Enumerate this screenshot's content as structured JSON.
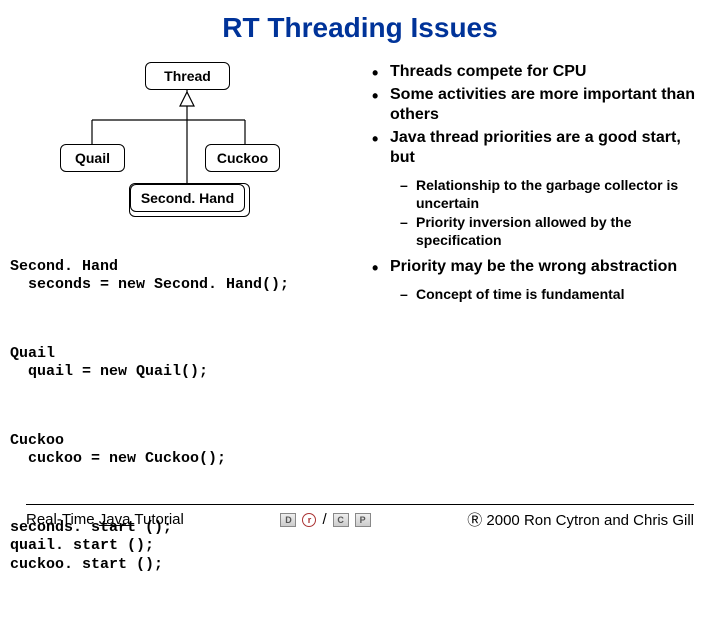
{
  "title": "RT Threading Issues",
  "diagram": {
    "thread": "Thread",
    "quail": "Quail",
    "cuckoo": "Cuckoo",
    "secondhand": "Second. Hand"
  },
  "code": {
    "sh_decl": "Second. Hand\n  seconds = new Second. Hand();",
    "quail_decl": "Quail\n  quail = new Quail();",
    "cuckoo_decl": "Cuckoo\n  cuckoo = new Cuckoo();",
    "starts": "seconds. start ();\nquail. start ();\ncuckoo. start ();"
  },
  "bullets": {
    "b1_1": "Threads compete for CPU",
    "b1_2": "Some activities are more important than others",
    "b1_3": "Java thread priorities are a good start, but",
    "b2_1": "Relationship to the garbage collector is uncertain",
    "b2_2": "Priority inversion allowed by the specification",
    "b1_4": "Priority may be the wrong abstraction",
    "b2_3": "Concept of time is fundamental"
  },
  "footer": {
    "left_prefix": "Real-Time ",
    "left_underline": "Java ",
    "left_suffix": "Tutorial",
    "logo_d": "D",
    "logo_r": "r",
    "logo_slash": "/",
    "logo_c": "C",
    "logo_p": "P",
    "right": "Ⓡ 2000 Ron Cytron and Chris Gill"
  }
}
